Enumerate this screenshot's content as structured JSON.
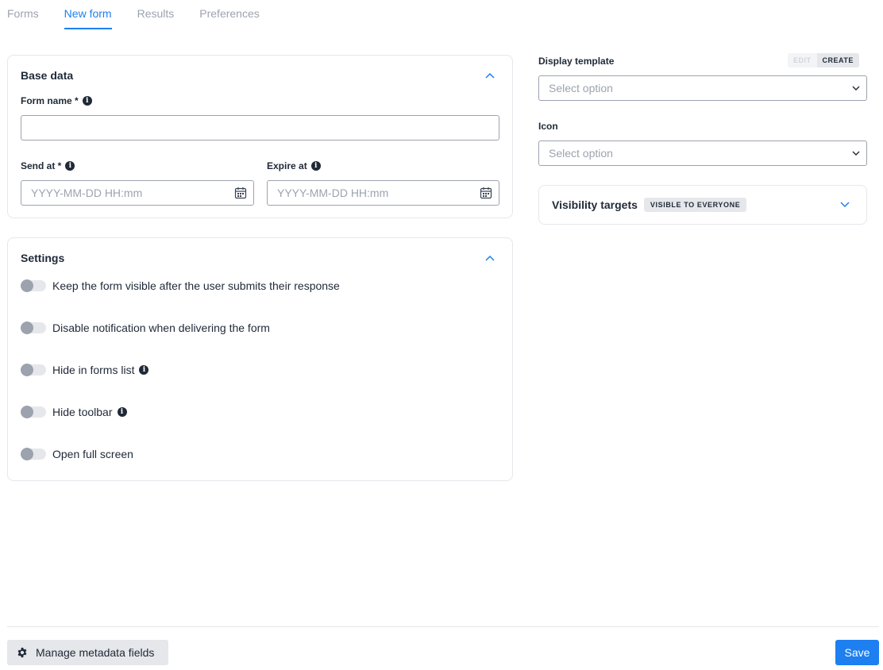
{
  "tabs": [
    {
      "label": "Forms"
    },
    {
      "label": "New form"
    },
    {
      "label": "Results"
    },
    {
      "label": "Preferences"
    }
  ],
  "base_data": {
    "title": "Base data",
    "form_name_label": "Form name *",
    "form_name_value": "",
    "send_at_label": "Send at *",
    "send_at_placeholder": "YYYY-MM-DD HH:mm",
    "expire_at_label": "Expire at",
    "expire_at_placeholder": "YYYY-MM-DD HH:mm"
  },
  "settings": {
    "title": "Settings",
    "toggles": [
      {
        "label": "Keep the form visible after the user submits their response",
        "on": false,
        "info": false
      },
      {
        "label": "Disable notification when delivering the form",
        "on": false,
        "info": false
      },
      {
        "label": "Hide in forms list",
        "on": false,
        "info": true
      },
      {
        "label": "Hide toolbar",
        "on": false,
        "info": true
      },
      {
        "label": "Open full screen",
        "on": false,
        "info": false
      }
    ]
  },
  "display_template": {
    "label": "Display template",
    "mode_edit": "EDIT",
    "mode_create": "CREATE",
    "active_mode": "CREATE",
    "placeholder": "Select option"
  },
  "icon_field": {
    "label": "Icon",
    "placeholder": "Select option"
  },
  "visibility": {
    "title": "Visibility targets",
    "badge": "VISIBLE TO EVERYONE"
  },
  "footer": {
    "metadata_button": "Manage metadata fields",
    "save_button": "Save"
  },
  "colors": {
    "accent": "#1d7ff0",
    "border": "#e5e7eb",
    "muted_text": "#9ca3af"
  }
}
